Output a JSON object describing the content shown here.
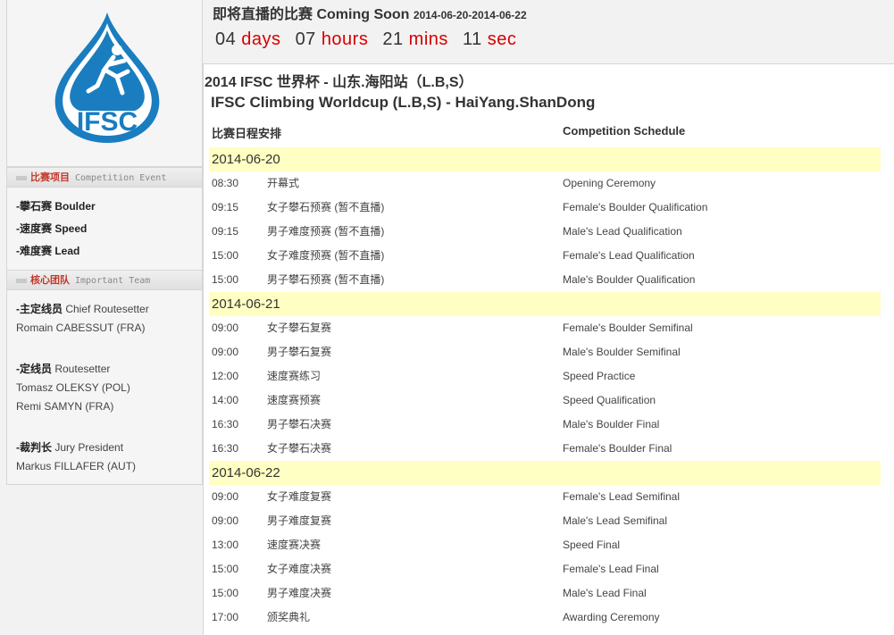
{
  "sidebar": {
    "logo_text": "IFSC",
    "event_section": {
      "title_cn": "比赛项目",
      "title_en": "Competition Event"
    },
    "events": [
      {
        "label": "-攀石赛 Boulder"
      },
      {
        "label": "-速度赛 Speed"
      },
      {
        "label": "-难度赛 Lead"
      }
    ],
    "team_section": {
      "title_cn": "核心团队",
      "title_en": "Important Team"
    },
    "team": [
      {
        "role_cn": "-主定线员",
        "role_en": "Chief Routesetter",
        "people": [
          "Romain CABESSUT (FRA)"
        ]
      },
      {
        "role_cn": "-定线员",
        "role_en": "Routesetter",
        "people": [
          "Tomasz OLEKSY (POL)",
          "Remi SAMYN (FRA)"
        ]
      },
      {
        "role_cn": "-裁判长",
        "role_en": "Jury President",
        "people": [
          "Markus FILLAFER (AUT)"
        ]
      }
    ]
  },
  "countdown": {
    "title": "即将直播的比赛 Coming Soon",
    "date_range": "2014-06-20-2014-06-22",
    "days": "04",
    "days_label": "days",
    "hours": "07",
    "hours_label": "hours",
    "mins": "21",
    "mins_label": "mins",
    "secs": "11",
    "secs_label": "sec"
  },
  "main": {
    "title_cn": "2014 IFSC 世界杯 - 山东.海阳站（L.B,S）",
    "title_en": "IFSC Climbing Worldcup (L.B,S) - HaiYang.ShanDong",
    "col_cn": "比赛日程安排",
    "col_en": "Competition Schedule",
    "days": [
      {
        "date": "2014-06-20",
        "rows": [
          {
            "time": "08:30",
            "cn": "开幕式",
            "en": "Opening Ceremony"
          },
          {
            "time": "09:15",
            "cn": "女子攀石预赛 (暂不直播)",
            "en": "Female's Boulder Qualification"
          },
          {
            "time": "09:15",
            "cn": "男子难度预赛 (暂不直播)",
            "en": "Male's Lead Qualification"
          },
          {
            "time": "15:00",
            "cn": "女子难度预赛 (暂不直播)",
            "en": "Female's Lead Qualification"
          },
          {
            "time": "15:00",
            "cn": "男子攀石预赛 (暂不直播)",
            "en": "Male's Boulder Qualification"
          }
        ]
      },
      {
        "date": "2014-06-21",
        "rows": [
          {
            "time": "09:00",
            "cn": "女子攀石复赛",
            "en": "Female's Boulder Semifinal"
          },
          {
            "time": "09:00",
            "cn": "男子攀石复赛",
            "en": "Male's Boulder Semifinal"
          },
          {
            "time": "12:00",
            "cn": "速度赛练习",
            "en": "Speed Practice"
          },
          {
            "time": "14:00",
            "cn": "速度赛预赛",
            "en": "Speed Qualification"
          },
          {
            "time": "16:30",
            "cn": "男子攀石决赛",
            "en": "Male's Boulder Final"
          },
          {
            "time": "16:30",
            "cn": "女子攀石决赛",
            "en": "Female's Boulder Final"
          }
        ]
      },
      {
        "date": "2014-06-22",
        "rows": [
          {
            "time": "09:00",
            "cn": "女子难度复赛",
            "en": "Female's Lead Semifinal"
          },
          {
            "time": "09:00",
            "cn": "男子难度复赛",
            "en": "Male's Lead Semifinal"
          },
          {
            "time": "13:00",
            "cn": "速度赛决赛",
            "en": "Speed Final"
          },
          {
            "time": "15:00",
            "cn": "女子难度决赛",
            "en": "Female's Lead Final"
          },
          {
            "time": "15:00",
            "cn": "男子难度决赛",
            "en": "Male's Lead Final"
          },
          {
            "time": "17:00",
            "cn": "颁奖典礼",
            "en": "Awarding Ceremony"
          }
        ]
      }
    ]
  },
  "colors": {
    "accent_red": "#d40000",
    "highlight_yellow": "#ffffc3",
    "logo_blue": "#1a7dc0"
  }
}
